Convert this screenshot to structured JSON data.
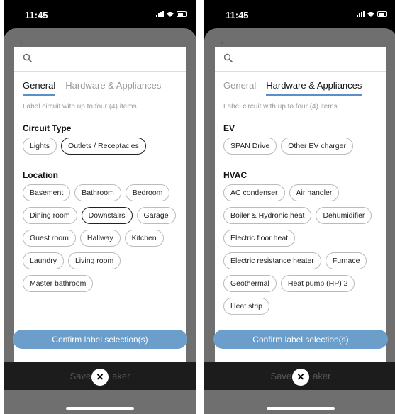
{
  "status": {
    "time": "11:45"
  },
  "search": {
    "placeholder": ""
  },
  "tabs": {
    "general": "General",
    "hardware": "Hardware & Appliances"
  },
  "hint": "Label circuit with up to four (4) items",
  "confirm_label": "Confirm label selection(s)",
  "save_label_left": "Save",
  "save_label_right": "aker",
  "close_glyph": "×",
  "colors": {
    "accent": "#6b9ecb",
    "tab_underline": "#5b8fc8",
    "backdrop": "#6f6f6f"
  },
  "left": {
    "active_tab": "General",
    "circuit_type": {
      "title": "Circuit Type",
      "items": [
        "Lights",
        "Outlets / Receptacles"
      ],
      "selected": "Outlets / Receptacles"
    },
    "location": {
      "title": "Location",
      "items": [
        "Basement",
        "Bathroom",
        "Bedroom",
        "Dining room",
        "Downstairs",
        "Garage",
        "Guest room",
        "Hallway",
        "Kitchen",
        "Laundry",
        "Living room",
        "Master bathroom"
      ],
      "selected": "Downstairs"
    }
  },
  "right": {
    "active_tab": "Hardware & Appliances",
    "ev": {
      "title": "EV",
      "items": [
        "SPAN Drive",
        "Other EV charger"
      ]
    },
    "hvac": {
      "title": "HVAC",
      "items": [
        "AC condenser",
        "Air handler",
        "Boiler & Hydronic heat",
        "Dehumidifier",
        "Electric floor heat",
        "Electric resistance heater",
        "Furnace",
        "Geothermal",
        "Heat pump (HP) 2",
        "Heat strip"
      ]
    }
  }
}
